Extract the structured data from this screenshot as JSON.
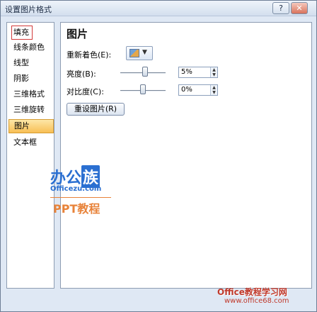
{
  "window": {
    "title": "设置图片格式",
    "help_label": "?",
    "close_label": "✕"
  },
  "nav": {
    "items": [
      {
        "label": "填充"
      },
      {
        "label": "线条颜色"
      },
      {
        "label": "线型"
      },
      {
        "label": "阴影"
      },
      {
        "label": "三维格式"
      },
      {
        "label": "三维旋转"
      },
      {
        "label": "图片",
        "selected": true
      },
      {
        "label": "文本框"
      }
    ]
  },
  "panel": {
    "title": "图片",
    "recolor_label": "重新着色(E):",
    "brightness_label": "亮度(B):",
    "brightness_value": "5%",
    "contrast_label": "对比度(C):",
    "contrast_value": "0%",
    "reset_button": "重设图片(R)"
  },
  "watermark": {
    "logo_text": "办公",
    "logo_box": "族",
    "logo_url": "Officezu.com",
    "logo_sub": "PPT教程",
    "corner_title": "Office教程学习网",
    "corner_url": "www.office68.com"
  }
}
